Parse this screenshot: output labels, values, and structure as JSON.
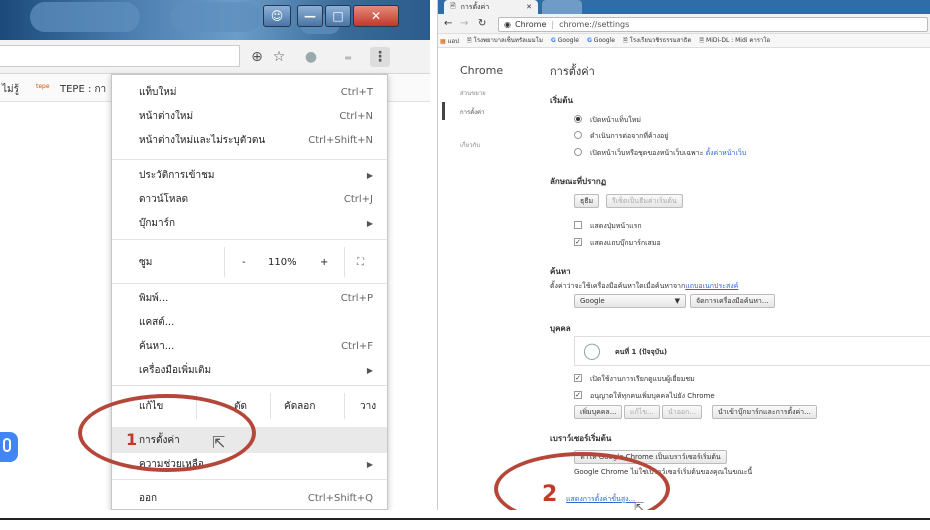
{
  "left": {
    "bookmarks": [
      {
        "label": "ไม่รู้"
      },
      {
        "label": "TEPE : กา"
      }
    ],
    "menu": {
      "items": [
        {
          "label": "แท็บใหม่",
          "shortcut": "Ctrl+T"
        },
        {
          "label": "หน้าต่างใหม่",
          "shortcut": "Ctrl+N"
        },
        {
          "label": "หน้าต่างใหม่และไม่ระบุตัวตน",
          "shortcut": "Ctrl+Shift+N"
        },
        {
          "label": "ประวัติการเข้าชม",
          "shortcut": ""
        },
        {
          "label": "ดาวน์โหลด",
          "shortcut": "Ctrl+J"
        },
        {
          "label": "บุ๊กมาร์ก",
          "shortcut": ""
        },
        {
          "label": "พิมพ์...",
          "shortcut": "Ctrl+P"
        },
        {
          "label": "แคสต์...",
          "shortcut": ""
        },
        {
          "label": "ค้นหา...",
          "shortcut": "Ctrl+F"
        },
        {
          "label": "เครื่องมือเพิ่มเติม",
          "shortcut": ""
        }
      ],
      "zoom": {
        "label": "ซูม",
        "minus": "-",
        "value": "110%",
        "plus": "+"
      },
      "edit": {
        "label": "แก้ไข",
        "cut": "ตัด",
        "copy": "คัดลอก",
        "paste": "วาง"
      },
      "settings": "การตั้งค่า",
      "help": "ความช่วยเหลือ",
      "exit": {
        "label": "ออก",
        "shortcut": "Ctrl+Shift+Q"
      }
    },
    "step_number": "1"
  },
  "right": {
    "tab_title": "การตั้งค่า",
    "omnibox": {
      "site": "Chrome",
      "url": "chrome://settings"
    },
    "bookmarks": [
      {
        "label": "แอป"
      },
      {
        "label": "โรงพยาบาลเซ็นทรัลเมมโม"
      },
      {
        "label": "Google"
      },
      {
        "label": "Google"
      },
      {
        "label": "โรงเรียนวชิรธรรมสาธิต"
      },
      {
        "label": "MiDi-DL : Midi คาราโอ"
      }
    ],
    "sidebar": {
      "title": "Chrome",
      "items": [
        "ส่วนขยาย",
        "การตั้งค่า",
        "เกี่ยวกับ"
      ]
    },
    "page_title": "การตั้งค่า",
    "startup": {
      "heading": "เริ่มต้น",
      "options": [
        "เปิดหน้าแท็บใหม่",
        "ดำเนินการต่อจากที่ค้างอยู่",
        "เปิดหน้าเว็บหรือชุดของหน้าเว็บเฉพาะ"
      ],
      "set_pages_link": "ตั้งค่าหน้าเว็บ"
    },
    "appearance": {
      "heading": "ลักษณะที่ปรากฏ",
      "themes_button": "ธุธีม",
      "reset_button": "รีเซ็ตเป็นธีมค่าเริ่มต้น",
      "checks": [
        {
          "label": "แสดงปุ่มหน้าแรก",
          "checked": false
        },
        {
          "label": "แสดงแถบบุ๊กมาร์กเสมอ",
          "checked": true
        }
      ]
    },
    "search": {
      "heading": "ค้นหา",
      "desc": "ตั้งค่าว่าจะใช้เครื่องมือค้นหาใดเมื่อค้นหาจาก",
      "omnibox_link": "แถบอเนกประสงค์",
      "engine": "Google",
      "manage_button": "จัดการเครื่องมือค้นหา..."
    },
    "people": {
      "heading": "บุคคล",
      "current_user": "คนที่ 1 (ปัจจุบัน)",
      "checks": [
        {
          "label": "เปิดใช้งานการเรียกดูแบบผู้เยี่ยมชม",
          "checked": true
        },
        {
          "label": "อนุญาตให้ทุกคนเพิ่มบุคคลไปยัง Chrome",
          "checked": true
        }
      ],
      "buttons": [
        "เพิ่มบุคคล...",
        "แก้ไข...",
        "นำออก...",
        "นำเข้าบุ๊กมาร์กและการตั้งค่า..."
      ]
    },
    "default_browser": {
      "heading": "เบราว์เซอร์เริ่มต้น",
      "button": "ทำให้ Google Chrome เป็นเบราว์เซอร์เริ่มต้น",
      "status": "Google Chrome ไม่ใช่เบราว์เซอร์เริ่มต้นของคุณในขณะนี้"
    },
    "advanced_link": "แสดงการตั้งค่าขั้นสูง...",
    "step_number": "2"
  },
  "colors": {
    "annotation": "#b5473a",
    "step": "#c0392b",
    "link": "#3367d6",
    "titlebar": "#2f6da8"
  }
}
